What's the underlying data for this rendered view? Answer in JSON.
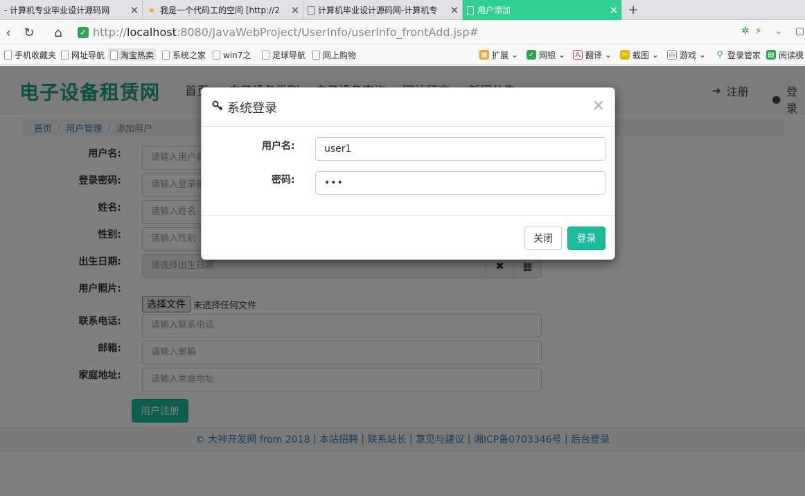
{
  "browser": {
    "tabs": [
      {
        "title": "- 计算机专业毕业设计源码网",
        "favicon": "page-icon"
      },
      {
        "title": "我是一个代码工的空间 [http://2",
        "favicon": "star-icon"
      },
      {
        "title": "计算机毕业设计源码网-计算机专",
        "favicon": "page-icon"
      },
      {
        "title": "用户添加",
        "favicon": "page-icon",
        "active": true
      }
    ],
    "url_scheme": "http://",
    "url_host": "localhost",
    "url_rest": ":8080/JavaWebProject/UserInfo/userInfo_frontAdd.jsp#",
    "bookmarks": [
      "手机收藏夹",
      "网址导航",
      "淘宝热卖",
      "系统之家",
      "win7之",
      "足球导航",
      "网上购物"
    ],
    "extensions": [
      "扩展",
      "网银",
      "翻译",
      "截图",
      "游戏",
      "登录管家",
      "阅读模"
    ],
    "accent_color": "#2fd08f"
  },
  "site": {
    "brand": "电子设备租赁网",
    "brand_color": "#16a085",
    "nav": [
      "首页",
      "电子设备类别",
      "电子设备查询",
      "网站留言",
      "新闻公告"
    ],
    "register_label": "注册",
    "login_label": "登录"
  },
  "breadcrumb": {
    "home": "首页",
    "section": "用户管理",
    "current": "添加用户"
  },
  "form": {
    "username_label": "用户名:",
    "username_placeholder": "请输入用户名",
    "password_label": "登录密码:",
    "password_placeholder": "请输入登录密码",
    "name_label": "姓名:",
    "name_placeholder": "请输入姓名",
    "gender_label": "性别:",
    "gender_placeholder": "请输入性别",
    "birthday_label": "出生日期:",
    "birthday_placeholder": "请选择出生日期",
    "photo_label": "用户照片:",
    "file_button": "选择文件",
    "file_status": "未选择任何文件",
    "phone_label": "联系电话:",
    "phone_placeholder": "请输入联系电话",
    "email_label": "邮箱:",
    "email_placeholder": "请输入邮箱",
    "address_label": "家庭地址:",
    "address_placeholder": "请输入家庭地址",
    "submit_label": "用户注册"
  },
  "footer": {
    "copyright": "© 大神开发网 from 2018",
    "links": [
      "本站招聘",
      "联系站长",
      "意见与建议",
      "湘ICP备0703346号",
      "后台登录"
    ]
  },
  "login_modal": {
    "title": "系统登录",
    "username_label": "用户名:",
    "username_value": "user1",
    "password_label": "密码:",
    "password_value": "•••",
    "close_label": "关闭",
    "login_label": "登录"
  }
}
